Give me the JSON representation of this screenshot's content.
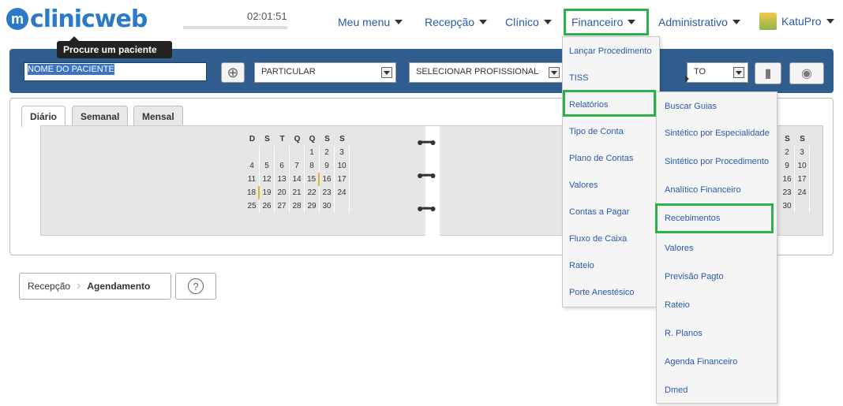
{
  "header": {
    "logo_icon": "m",
    "logo_text": "clinicweb",
    "clock": "02:01:51",
    "nav": [
      {
        "label": "Meu menu"
      },
      {
        "label": "Recepção"
      },
      {
        "label": "Clínico"
      },
      {
        "label": "Financeiro"
      },
      {
        "label": "Administrativo"
      },
      {
        "label": "KatuPro"
      }
    ]
  },
  "tooltip": "Procure um paciente",
  "toolbar": {
    "patient_value": "NOME DO PACIENTE",
    "plan_value": "PARTICULAR",
    "professional_value": "SELECIONAR PROFISSIONAL",
    "third_select_value": "TO",
    "add_icon": "⊕",
    "book_icon": "▮",
    "eye_icon": "◉"
  },
  "tabs": [
    {
      "label": "Diário"
    },
    {
      "label": "Semanal"
    },
    {
      "label": "Mensal"
    }
  ],
  "calendar": {
    "weekdays": [
      "D",
      "S",
      "T",
      "Q",
      "Q",
      "S",
      "S"
    ],
    "left_month": [
      [
        "",
        "",
        "",
        "",
        "1",
        "2",
        "3"
      ],
      [
        "4",
        "5",
        "6",
        "7",
        "8",
        "9",
        "10"
      ],
      [
        "11",
        "12",
        "13",
        "14",
        "15",
        "16",
        "17"
      ],
      [
        "18",
        "19",
        "20",
        "21",
        "22",
        "23",
        "24"
      ],
      [
        "25",
        "26",
        "27",
        "28",
        "29",
        "30",
        ""
      ]
    ],
    "right_month_cols": {
      "headers": [
        "S",
        "S"
      ],
      "rows": [
        [
          "2",
          "3"
        ],
        [
          "9",
          "10"
        ],
        [
          "16",
          "17"
        ],
        [
          "23",
          "24"
        ],
        [
          "30",
          ""
        ]
      ]
    }
  },
  "breadcrumb": {
    "root": "Recepção",
    "current": "Agendamento",
    "help_icon": "?"
  },
  "financeiro_menu": [
    "Lançar Procedimento",
    "TISS",
    "Relatórios",
    "Tipo de Conta",
    "Plano de Contas",
    "Valores",
    "Contas a Pagar",
    "Fluxo de Caixa",
    "Rateio",
    "Porte Anestésico"
  ],
  "relatorios_submenu": [
    "Buscar Guias",
    "Sintético por Especialidade",
    "Sintético por Procedimento",
    "Analítico Financeiro",
    "Recebimentos",
    "Valores",
    "Previsão Pagto",
    "Rateio",
    "R. Planos",
    "Agenda Financeiro",
    "Dmed"
  ],
  "colors": {
    "brand": "#2a7ac8",
    "toolbar": "#2f5d8e",
    "highlight": "#2bb34a",
    "link": "#2a5aa8"
  }
}
